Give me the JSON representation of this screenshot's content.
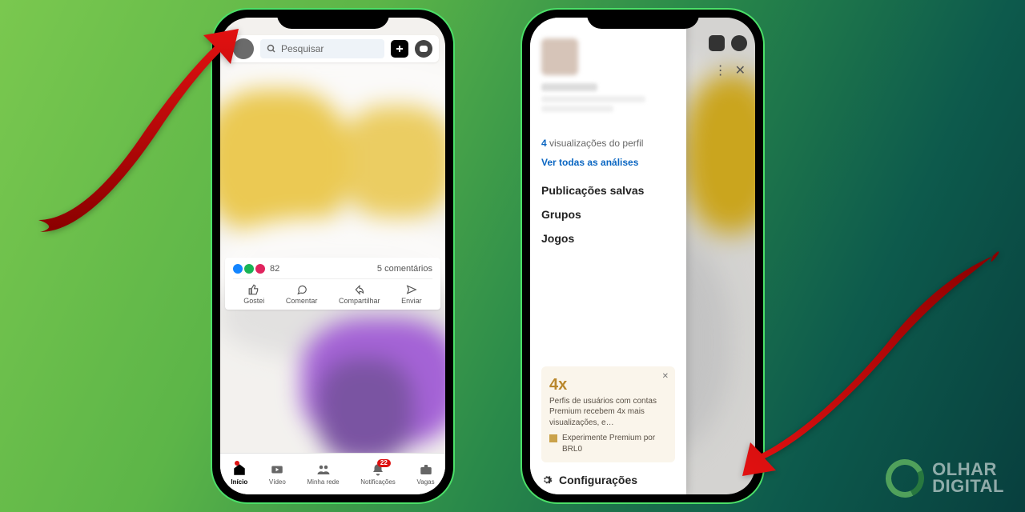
{
  "search": {
    "placeholder": "Pesquisar"
  },
  "post": {
    "reactions_count": "82",
    "comments_text": "5 comentários",
    "actions": {
      "like": "Gostei",
      "comment": "Comentar",
      "share": "Compartilhar",
      "send": "Enviar"
    }
  },
  "bottomnav": {
    "home": "Início",
    "video": "Vídeo",
    "network": "Minha rede",
    "notif": "Notificações",
    "jobs": "Vagas",
    "notif_badge": "22"
  },
  "drawer": {
    "profile_views_count": "4",
    "profile_views_label": " visualizações do perfil",
    "analytics_link": "Ver todas as análises",
    "menu": {
      "saved": "Publicações salvas",
      "groups": "Grupos",
      "games": "Jogos"
    },
    "premium": {
      "multiplier": "4x",
      "body": "Perfis de usuários com contas Premium recebem 4x mais visualizações, e…",
      "cta": "Experimente Premium por BRL0"
    },
    "settings": "Configurações"
  },
  "brand": {
    "line1": "OLHAR",
    "line2": "DIGITAL"
  }
}
